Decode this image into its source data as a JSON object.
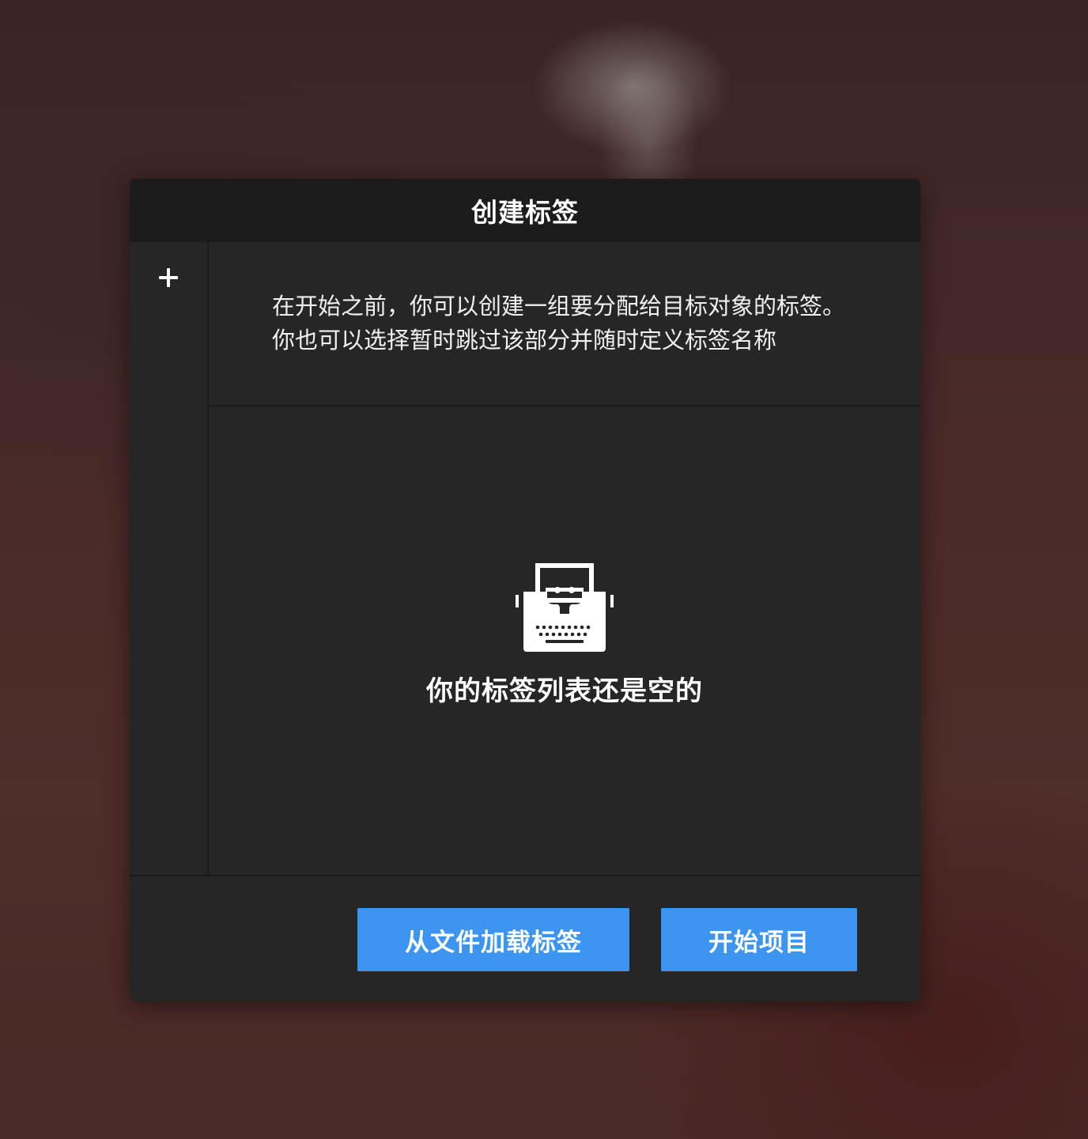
{
  "dialog": {
    "title": "创建标签",
    "intro_text": "在开始之前，你可以创建一组要分配给目标对象的标签。你也可以选择暂时跳过该部分并随时定义标签名称",
    "empty_message": "你的标签列表还是空的",
    "empty_icon": "typewriter-icon",
    "add_icon": "plus-icon"
  },
  "footer": {
    "load_label": "从文件加载标签",
    "start_label": "开始项目"
  },
  "colors": {
    "dialog_bg": "#262626",
    "header_bg": "#1c1c1c",
    "accent": "#3d95f0",
    "text": "#ffffff"
  }
}
